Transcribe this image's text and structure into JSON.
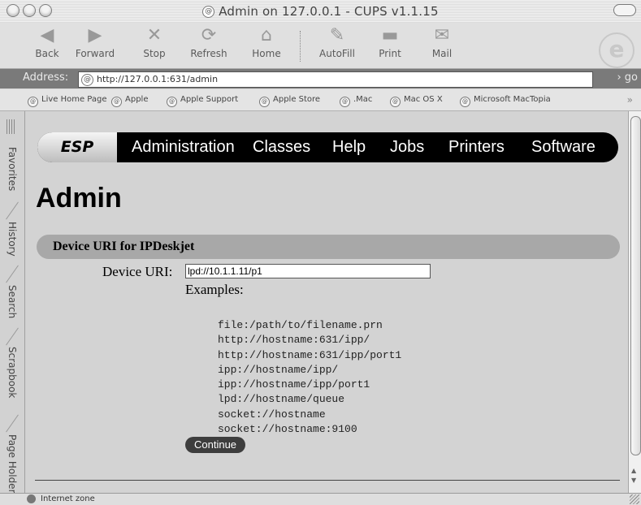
{
  "window": {
    "title": "Admin on 127.0.0.1 - CUPS v1.1.15"
  },
  "toolbar": {
    "back": "Back",
    "forward": "Forward",
    "stop": "Stop",
    "refresh": "Refresh",
    "home": "Home",
    "autofill": "AutoFill",
    "print": "Print",
    "mail": "Mail"
  },
  "address": {
    "label": "Address:",
    "url": "http://127.0.0.1:631/admin",
    "go": "go"
  },
  "favorites": [
    "Live Home Page",
    "Apple",
    "Apple Support",
    "Apple Store",
    ".Mac",
    "Mac OS X",
    "Microsoft MacTopia"
  ],
  "sidebar_tabs": [
    "Favorites",
    "History",
    "Search",
    "Scrapbook",
    "Page Holder"
  ],
  "nav": {
    "logo": "ESP",
    "items": [
      "Administration",
      "Classes",
      "Help",
      "Jobs",
      "Printers",
      "Software"
    ]
  },
  "page": {
    "heading": "Admin",
    "section_title": "Device URI for IPDeskjet",
    "uri_label": "Device URI:",
    "uri_value": "lpd://10.1.1.11/p1",
    "examples_label": "Examples:",
    "examples": [
      "file:/path/to/filename.prn",
      "http://hostname:631/ipp/",
      "http://hostname:631/ipp/port1",
      "ipp://hostname/ipp/",
      "ipp://hostname/ipp/port1",
      "lpd://hostname/queue",
      "socket://hostname",
      "socket://hostname:9100"
    ],
    "continue_label": "Continue"
  },
  "status": {
    "zone": "Internet zone"
  },
  "icons": {
    "back": "back-arrow-icon",
    "forward": "forward-arrow-icon",
    "stop": "stop-x-icon",
    "refresh": "refresh-icon",
    "home": "home-icon",
    "autofill": "autofill-icon",
    "print": "printer-icon",
    "mail": "mail-envelope-icon"
  }
}
